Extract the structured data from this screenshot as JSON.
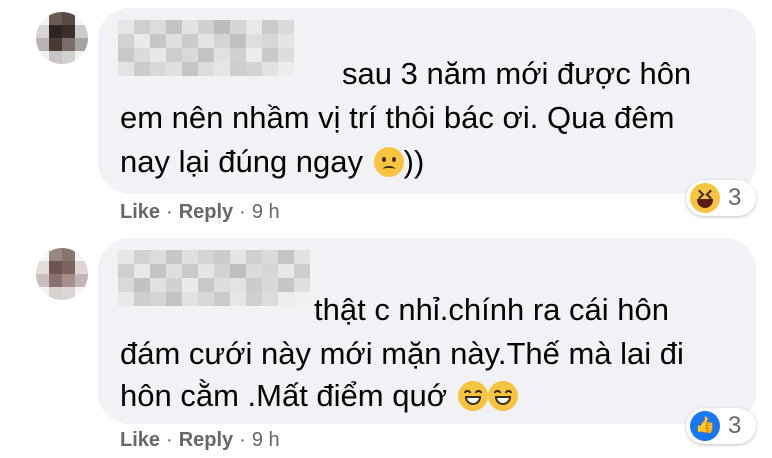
{
  "comments": [
    {
      "lines": [
        "sau 3 năm mới được hôn",
        "em nên nhầm vị trí thôi bác ơi. Qua đêm",
        "nay lại đúng ngay"
      ],
      "line3_suffix": "))",
      "inline_emoji": [
        "sad-face-emoji"
      ],
      "reaction": {
        "type": "haha-reaction-icon",
        "count": "3"
      },
      "actions": {
        "like": "Like",
        "reply": "Reply",
        "time": "9 h",
        "separator": "·"
      }
    },
    {
      "lines": [
        "thật c nhỉ.chính ra cái hôn",
        "đám cưới này mới mặn này.Thế mà lai đi",
        "hôn cằm .Mất điểm quớ"
      ],
      "line3_suffix": "",
      "inline_emoji": [
        "grinning-face-emoji",
        "grinning-face-emoji"
      ],
      "reaction": {
        "type": "like-reaction-icon",
        "count": "3"
      },
      "actions": {
        "like": "Like",
        "reply": "Reply",
        "time": "9 h",
        "separator": "·"
      }
    }
  ],
  "colors": {
    "bubble": "#f0f2f5",
    "meta_text": "#65676b",
    "like_blue": "#1877f2",
    "emoji_yellow": "#f7c43f"
  }
}
